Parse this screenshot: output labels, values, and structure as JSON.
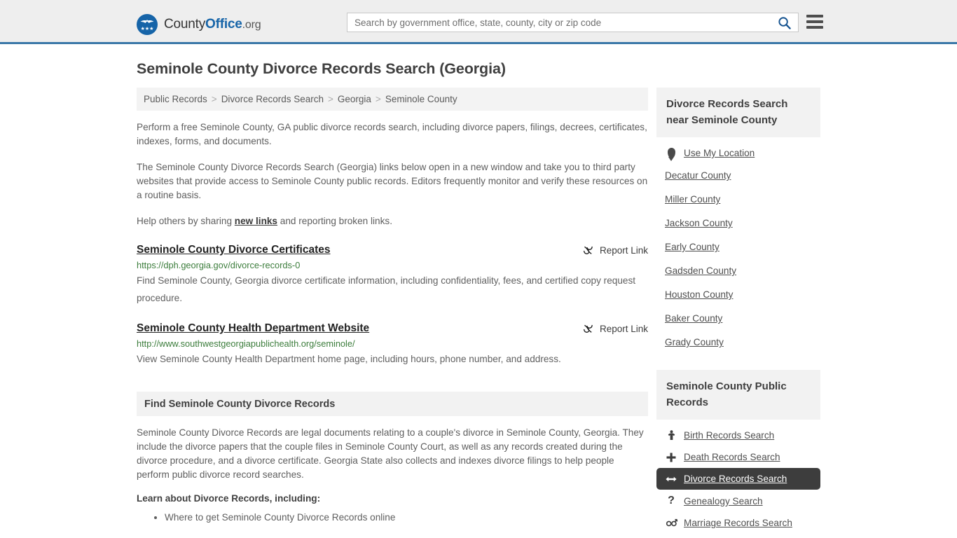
{
  "header": {
    "brand": {
      "part1": "County",
      "part2": "Office",
      "part3": ".org",
      "logo_icon": "eagle-shield-logo",
      "stars": "★★★"
    },
    "search": {
      "placeholder": "Search by government office, state, county, city or zip code",
      "value": "",
      "button_icon": "search-icon"
    },
    "menu_icon": "hamburger-menu-icon"
  },
  "page": {
    "title": "Seminole County Divorce Records Search (Georgia)",
    "breadcrumb": [
      {
        "label": "Public Records",
        "current": false
      },
      {
        "label": "Divorce Records Search",
        "current": false
      },
      {
        "label": "Georgia",
        "current": false
      },
      {
        "label": "Seminole County",
        "current": true
      }
    ],
    "breadcrumb_separator": ">",
    "intro_paragraphs": [
      "Perform a free Seminole County, GA public divorce records search, including divorce papers, filings, decrees, certificates, indexes, forms, and documents.",
      "The Seminole County Divorce Records Search (Georgia) links below open in a new window and take you to third party websites that provide access to Seminole County public records. Editors frequently monitor and verify these resources on a routine basis."
    ],
    "help_line": {
      "before": "Help others by sharing ",
      "link": "new links",
      "after": " and reporting broken links."
    }
  },
  "results": [
    {
      "title": "Seminole County Divorce Certificates",
      "url": "https://dph.georgia.gov/divorce-records-0",
      "description": "Find Seminole County, Georgia divorce certificate information, including confidentiality, fees, and certified copy request procedure.",
      "report_label": "Report Link",
      "report_icon": "broken-link-icon"
    },
    {
      "title": "Seminole County Health Department Website",
      "url": "http://www.southwestgeorgiapublichealth.org/seminole/",
      "description": "View Seminole County Health Department home page, including hours, phone number, and address.",
      "report_label": "Report Link",
      "report_icon": "broken-link-icon"
    }
  ],
  "find_section": {
    "heading": "Find Seminole County Divorce Records",
    "paragraph": "Seminole County Divorce Records are legal documents relating to a couple's divorce in Seminole County, Georgia. They include the divorce papers that the couple files in Seminole County Court, as well as any records created during the divorce procedure, and a divorce certificate. Georgia State also collects and indexes divorce filings to help people perform public divorce record searches.",
    "lead_in": "Learn about Divorce Records, including:",
    "bullets": [
      "Where to get Seminole County Divorce Records online"
    ]
  },
  "sidebar": {
    "nearby": {
      "heading": "Divorce Records Search near Seminole County",
      "use_my_location": {
        "label": "Use My Location",
        "icon": "map-pin-icon"
      },
      "counties": [
        {
          "label": "Decatur County"
        },
        {
          "label": "Miller County"
        },
        {
          "label": "Jackson County"
        },
        {
          "label": "Early County"
        },
        {
          "label": "Gadsden County"
        },
        {
          "label": "Houston County"
        },
        {
          "label": "Baker County"
        },
        {
          "label": "Grady County"
        }
      ]
    },
    "public_records": {
      "heading": "Seminole County Public Records",
      "items": [
        {
          "label": "Birth Records Search",
          "icon": "baby-icon",
          "glyph": "Ш",
          "active": false
        },
        {
          "label": "Death Records Search",
          "icon": "cross-icon",
          "glyph": "✚",
          "active": false
        },
        {
          "label": "Divorce Records Search",
          "icon": "left-right-arrow-icon",
          "glyph": "↔",
          "active": true
        },
        {
          "label": "Genealogy Search",
          "icon": "question-mark-icon",
          "glyph": "?",
          "active": false
        },
        {
          "label": "Marriage Records Search",
          "icon": "male-female-icon",
          "glyph": "⚥",
          "active": false
        }
      ]
    }
  },
  "colors": {
    "header_bg": "#eeeeee",
    "header_border": "#3a78a8",
    "brand_blue": "#1664a8",
    "url_green": "#3c7d3c",
    "panel_bg": "#f2f2f2",
    "active_bg": "#3d3d3d"
  }
}
